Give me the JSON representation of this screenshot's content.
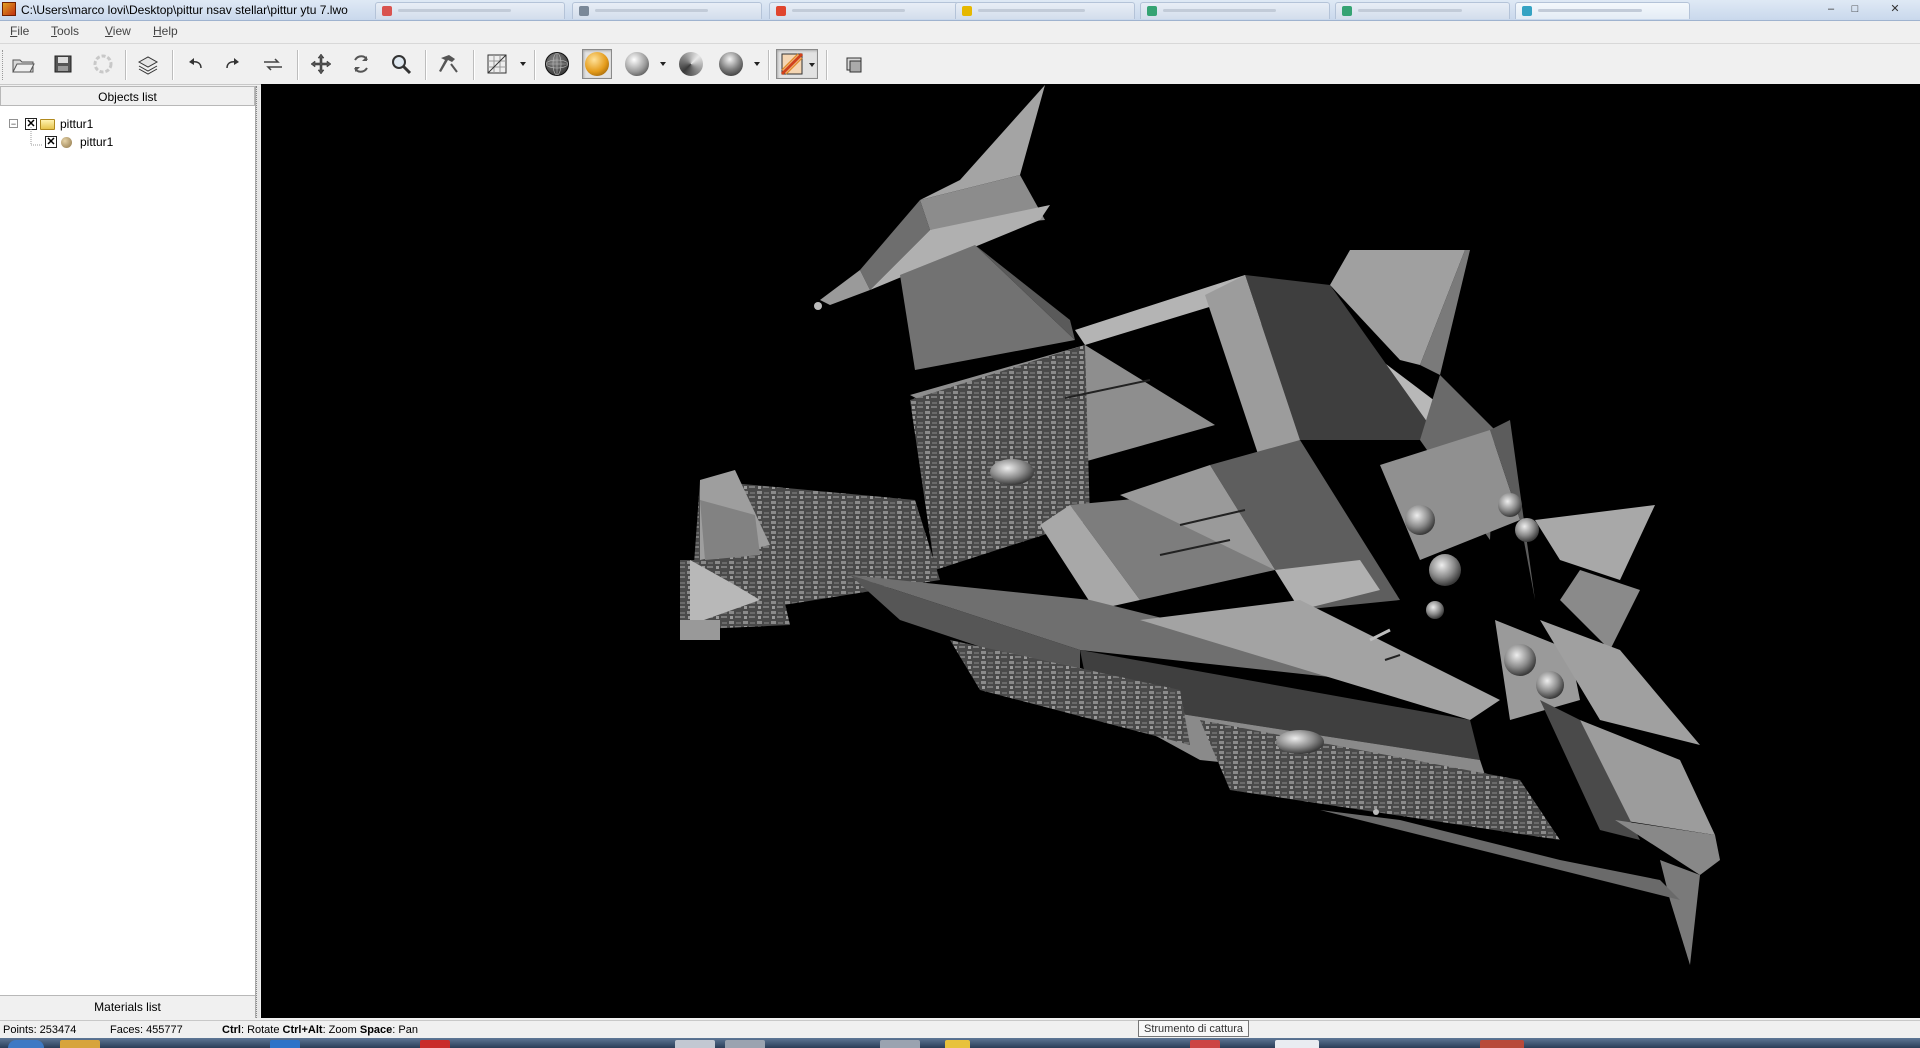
{
  "window": {
    "title": "C:\\Users\\marco lovi\\Desktop\\pittur nsav stellar\\pittur ytu 7.lwo",
    "controls": {
      "minimize": "–",
      "maximize": "□",
      "close": "✕"
    }
  },
  "menubar": {
    "items": [
      {
        "accel": "F",
        "rest": "ile"
      },
      {
        "accel": "T",
        "rest": "ools"
      },
      {
        "accel": "V",
        "rest": "iew"
      },
      {
        "accel": "H",
        "rest": "elp"
      }
    ]
  },
  "toolbar": {
    "icons": [
      "open-folder-icon",
      "save-icon",
      "reload-icon",
      "layers-icon",
      "undo-icon",
      "redo-icon",
      "repeat-icon",
      "move-icon",
      "rotate-icon",
      "zoom-icon",
      "hammer-icon",
      "texture-icon",
      "wireframe-sphere-icon",
      "shaded-sphere-icon",
      "smooth-sphere-icon",
      "flat-sphere-icon",
      "lit-sphere-icon",
      "material-icon",
      "screenshot-icon"
    ],
    "pressed": [
      "shaded-sphere-icon",
      "material-icon"
    ]
  },
  "left_panel": {
    "objects_header": "Objects list",
    "materials_header": "Materials list",
    "tree": [
      {
        "label": "pittur1",
        "checked": "✕",
        "expander": "−",
        "icon": "folder-icon"
      },
      {
        "label": "pittur1",
        "checked": "✕",
        "icon": "sphere-object-icon"
      }
    ]
  },
  "status": {
    "points": "Points: 253474",
    "faces": "Faces: 455777",
    "hint_ctrl_key": "Ctrl",
    "hint_rotate": ": Rotate ",
    "hint_ctrlalt_key": "Ctrl+Alt",
    "hint_zoom": ": Zoom ",
    "hint_space_key": "Space",
    "hint_pan": ": Pan"
  },
  "tooltip": "Strumento di cattura",
  "colors": {
    "viewport_bg": "#000000",
    "model_light": "#a9a9a9",
    "model_mid": "#7c7c7c",
    "model_dark": "#3e3e3e",
    "pressed_button": "#e2e2e2"
  }
}
